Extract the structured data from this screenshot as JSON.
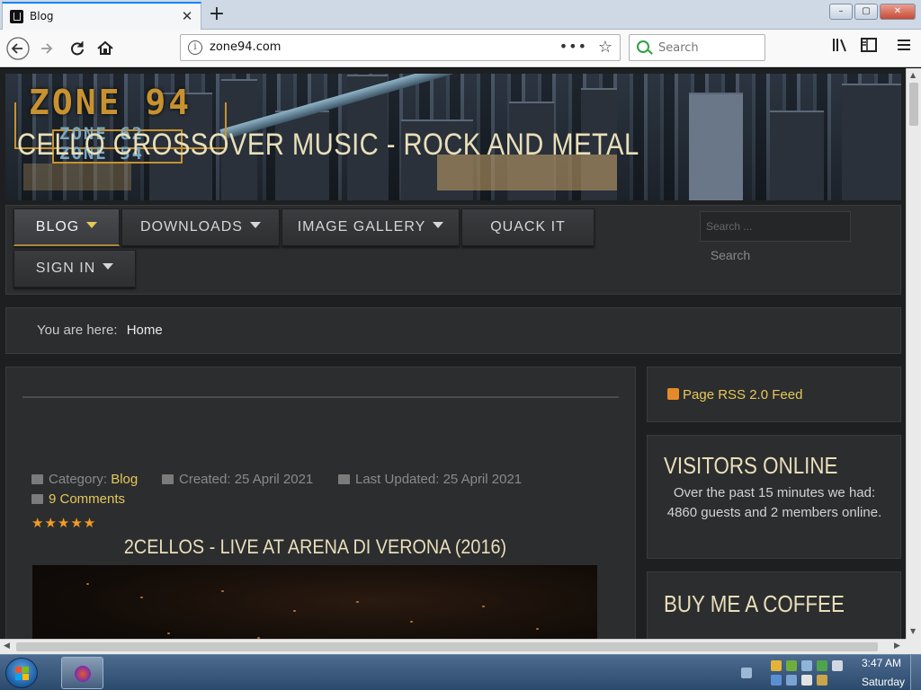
{
  "browser": {
    "tab_title": "Blog",
    "url": "zone94.com",
    "search_placeholder": "Search",
    "window_controls": {
      "minimize": "–",
      "maximize": "▢",
      "close": "✕"
    }
  },
  "site": {
    "logo": {
      "main": "ZONE 94",
      "sub1": "ZONE 62",
      "sub2": "ZONE 54"
    },
    "menu": [
      {
        "label": "BLOG",
        "has_caret": true,
        "active": true
      },
      {
        "label": "DOWNLOADS",
        "has_caret": true
      },
      {
        "label": "IMAGE GALLERY",
        "has_caret": true
      },
      {
        "label": "QUACK IT",
        "has_caret": false
      },
      {
        "label": "SIGN IN",
        "has_caret": true
      }
    ],
    "search": {
      "placeholder": "Search ...",
      "button": "Search"
    },
    "breadcrumb": {
      "prefix": "You are here:",
      "current": "Home"
    }
  },
  "article": {
    "title": "CELLO CROSSOVER MUSIC - ROCK AND METAL",
    "category_label": "Category:",
    "category": "Blog",
    "created": "Created: 25 April 2021",
    "updated": "Last Updated: 25 April 2021",
    "comments": "9 Comments",
    "rating": "★★★★★",
    "video_title": "2CELLOS - LIVE AT ARENA DI VERONA (2016)"
  },
  "sidebar": {
    "rss": "Page RSS 2.0 Feed",
    "visitors_title": "VISITORS ONLINE",
    "visitors_text": "Over the past 15 minutes we had: 4860 guests and 2 members online.",
    "coffee_title": "BUY ME A COFFEE"
  },
  "taskbar": {
    "time": "3:47 AM",
    "day": "Saturday"
  },
  "colors": {
    "accent_gold": "#e4c95a",
    "title_cream": "#e9dfb9",
    "page_bg": "#1e1f20",
    "panel_bg": "#2c2d2f",
    "star_orange": "#f29c22"
  }
}
